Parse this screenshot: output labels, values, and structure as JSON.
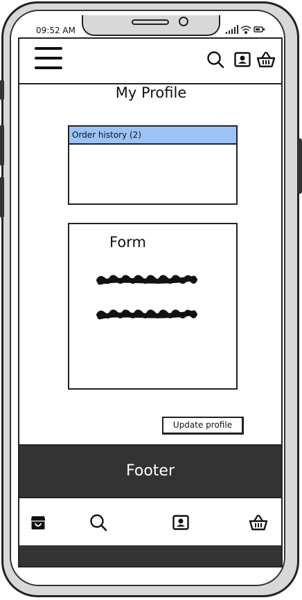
{
  "status_bar": {
    "time": "09:52 AM"
  },
  "page": {
    "title": "My Profile"
  },
  "order_history": {
    "label": "Order history (2)"
  },
  "form": {
    "title": "Form"
  },
  "actions": {
    "update_label": "Update profile"
  },
  "footer": {
    "label": "Footer"
  },
  "colors": {
    "accent": "#9dc3f6",
    "footer_bg": "#333333"
  }
}
